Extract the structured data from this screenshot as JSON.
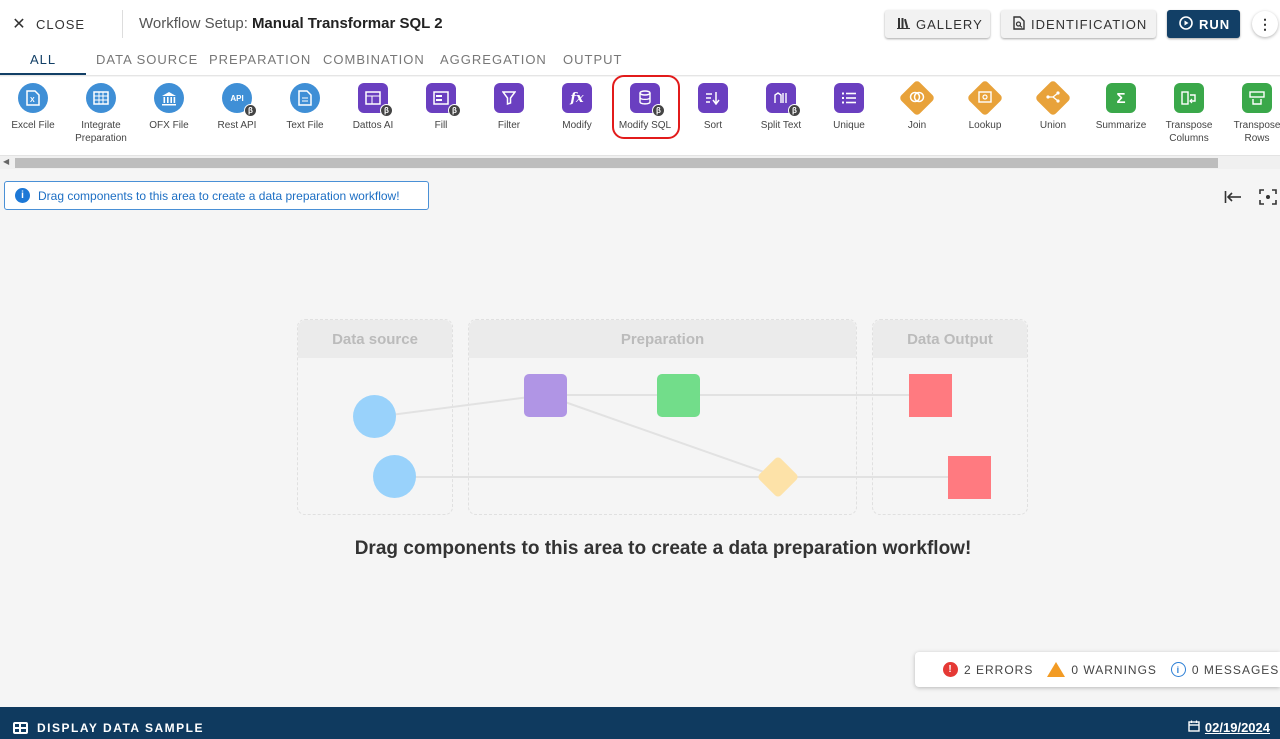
{
  "header": {
    "close_label": "CLOSE",
    "title_prefix": "Workflow Setup:",
    "title_name": "Manual Transformar SQL 2",
    "gallery_label": "GALLERY",
    "identification_label": "IDENTIFICATION",
    "run_label": "RUN"
  },
  "tabs": [
    "ALL",
    "DATA SOURCE",
    "PREPARATION",
    "COMBINATION",
    "AGGREGATION",
    "OUTPUT"
  ],
  "active_tab": "ALL",
  "tools": [
    {
      "label": "Excel File",
      "icon": "excel-icon",
      "color": "#3f8fd6"
    },
    {
      "label": "Integrate Preparation",
      "icon": "table-grid-icon",
      "color": "#3f8fd6"
    },
    {
      "label": "OFX File",
      "icon": "bank-icon",
      "color": "#3f8fd6"
    },
    {
      "label": "Rest API",
      "icon": "api-icon",
      "color": "#3f8fd6",
      "beta": true
    },
    {
      "label": "Text File",
      "icon": "text-file-icon",
      "color": "#3f8fd6"
    },
    {
      "label": "Dattos AI",
      "icon": "ai-table-icon",
      "color": "#6a3fc0",
      "beta": true
    },
    {
      "label": "Fill",
      "icon": "fill-icon",
      "color": "#6a3fc0",
      "beta": true
    },
    {
      "label": "Filter",
      "icon": "filter-icon",
      "color": "#6a3fc0"
    },
    {
      "label": "Modify",
      "icon": "function-icon",
      "color": "#6a3fc0"
    },
    {
      "label": "Modify SQL",
      "icon": "database-icon",
      "color": "#6a3fc0",
      "beta": true
    },
    {
      "label": "Sort",
      "icon": "sort-icon",
      "color": "#6a3fc0"
    },
    {
      "label": "Split Text",
      "icon": "split-text-icon",
      "color": "#6a3fc0",
      "beta": true
    },
    {
      "label": "Unique",
      "icon": "list-icon",
      "color": "#6a3fc0"
    },
    {
      "label": "Join",
      "icon": "join-icon",
      "color": "#e8a23a"
    },
    {
      "label": "Lookup",
      "icon": "lookup-icon",
      "color": "#e8a23a"
    },
    {
      "label": "Union",
      "icon": "union-icon",
      "color": "#e8a23a"
    },
    {
      "label": "Summarize",
      "icon": "sigma-icon",
      "color": "#3aa84a"
    },
    {
      "label": "Transpose Columns",
      "icon": "transpose-columns-icon",
      "color": "#3aa84a"
    },
    {
      "label": "Transpose Rows",
      "icon": "transpose-rows-icon",
      "color": "#3aa84a"
    }
  ],
  "canvas": {
    "info_banner": "Drag components to this area to create a data preparation workflow!",
    "empty_text": "Drag components to this area to create a data preparation workflow!",
    "diagram_columns": [
      "Data source",
      "Preparation",
      "Data Output"
    ]
  },
  "status": {
    "errors": "2 ERRORS",
    "warnings": "0 WARNINGS",
    "messages": "0 MESSAGES"
  },
  "footer": {
    "display_sample_label": "DISPLAY DATA SAMPLE",
    "date": "02/19/2024"
  }
}
